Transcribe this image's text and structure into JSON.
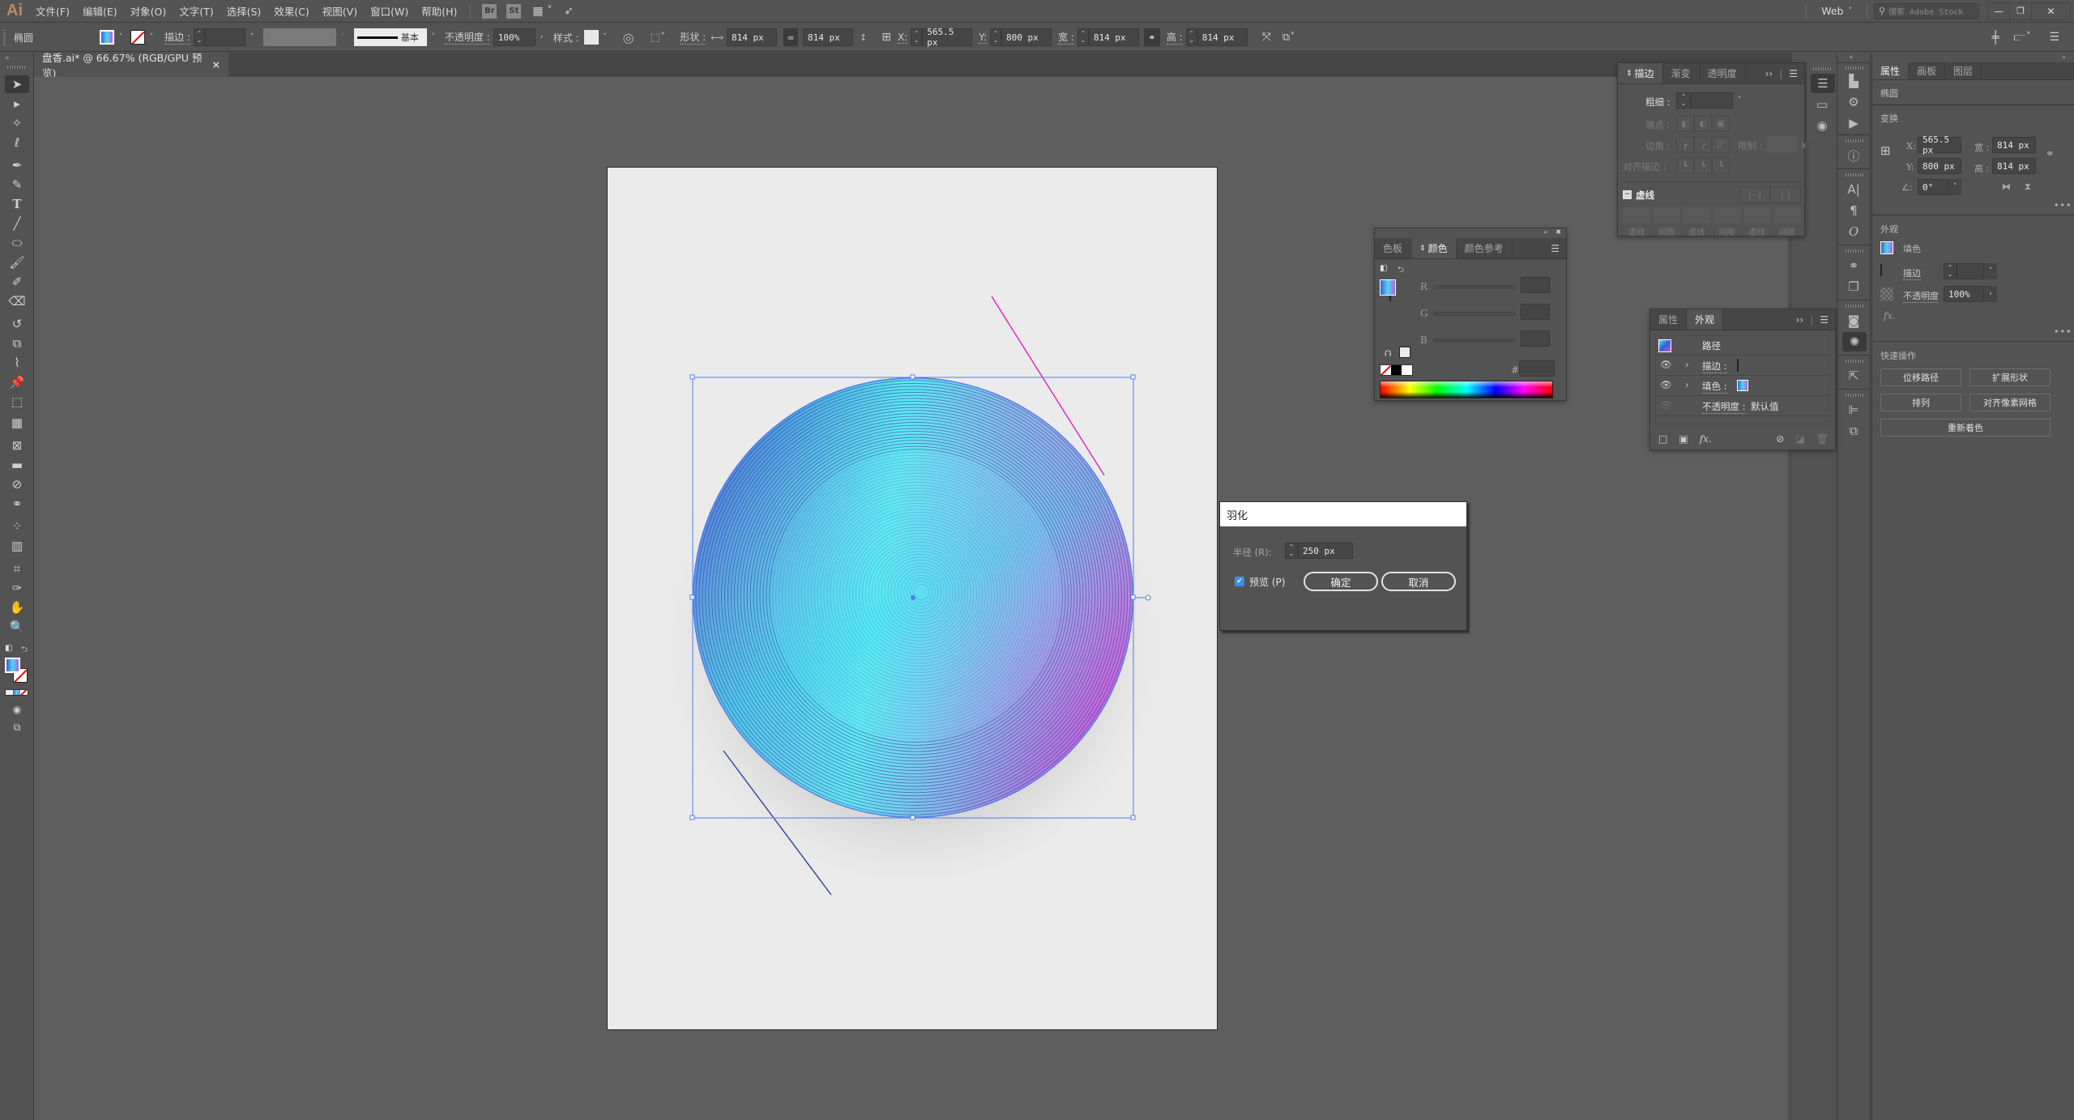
{
  "app": {
    "logo": "Ai",
    "workspace": "Web",
    "stock_search_placeholder": "搜索 Adobe Stock"
  },
  "menu": [
    "文件(F)",
    "编辑(E)",
    "对象(O)",
    "文字(T)",
    "选择(S)",
    "效果(C)",
    "视图(V)",
    "窗口(W)",
    "帮助(H)"
  ],
  "menu_icons": {
    "bridge": "Br",
    "stock": "St"
  },
  "control_bar": {
    "object_type": "椭圆",
    "stroke_label": "描边 :",
    "stroke_profile": "基本",
    "opacity_label": "不透明度 :",
    "opacity_value": "100%",
    "style_label": "样式 :",
    "shape_label": "形状 :",
    "shape_w": "814 px",
    "shape_h": "814 px",
    "x_label": "X:",
    "x_value": "565.5 px",
    "y_label": "Y:",
    "y_value": "800 px",
    "w_label": "宽 :",
    "w_value": "814 px",
    "h_label": "高 :",
    "h_value": "814 px"
  },
  "document_tab": {
    "title": "盘香.ai* @ 66.67% (RGB/GPU 预览)",
    "close": "×"
  },
  "tools": [
    "selection",
    "direct-selection",
    "magic-wand",
    "lasso",
    "pen",
    "curvature",
    "type",
    "line-segment",
    "ellipse",
    "paintbrush",
    "shaper",
    "eraser",
    "rotate",
    "scale",
    "puppet-warp",
    "pin",
    "free-transform",
    "perspective-grid",
    "mesh",
    "gradient",
    "eyedropper",
    "blend",
    "symbol-sprayer",
    "column-graph",
    "artboard",
    "slice",
    "hand",
    "zoom"
  ],
  "stroke_panel": {
    "tabs": [
      "描边",
      "渐变",
      "透明度"
    ],
    "active_tab": 0,
    "weight_label": "粗细 :",
    "cap_label": "端点 :",
    "corner_label": "边角 :",
    "limit_label": "限制 :",
    "limit_suffix": "x",
    "align_label": "对齐描边 :",
    "dashed_label": "虚线",
    "dash_fields": [
      "虚线",
      "间隙",
      "虚线",
      "间隙",
      "虚线",
      "间隙"
    ]
  },
  "color_panel": {
    "tabs": [
      "色板",
      "颜色",
      "颜色参考"
    ],
    "active_tab": 1,
    "channels": [
      "R",
      "G",
      "B"
    ],
    "hex_label": "#"
  },
  "appearance_panel": {
    "tabs": [
      "属性",
      "外观"
    ],
    "active_tab": 1,
    "object": "路径",
    "rows": [
      {
        "label": "描边 :",
        "swatch": "none",
        "visible": true
      },
      {
        "label": "填色 :",
        "swatch": "gradient",
        "visible": true
      },
      {
        "label": "不透明度 :",
        "value": "默认值",
        "visible": false
      }
    ],
    "fx": "fx."
  },
  "feather_dialog": {
    "title": "羽化",
    "radius_label": "半径 (R):",
    "radius_value": "250 px",
    "preview_label": "预览 (P)",
    "preview_checked": true,
    "ok": "确定",
    "cancel": "取消"
  },
  "properties_panel": {
    "tabs": [
      "属性",
      "画板",
      "图层"
    ],
    "active_tab": 0,
    "object_type": "椭圆",
    "transform_title": "变换",
    "x_label": "X:",
    "x_value": "565.5 px",
    "y_label": "Y:",
    "y_value": "800 px",
    "w_label": "宽 :",
    "w_value": "814 px",
    "h_label": "高 :",
    "h_value": "814 px",
    "angle_value": "0°",
    "appearance_title": "外观",
    "fill_label": "填色",
    "stroke_label": "描边",
    "opacity_label": "不透明度",
    "opacity_value": "100%",
    "fx": "fx.",
    "quick_actions_title": "快速操作",
    "quick_actions": [
      "位移路径",
      "扩展形状",
      "排列",
      "对齐像素网格",
      "重新着色"
    ]
  },
  "colors": {
    "gradient_start": "#3a5ed8",
    "gradient_mid": "#45e3ef",
    "gradient_end": "#c250d8",
    "selection": "#4f7cf0",
    "stroke_line_top": "#e020c8",
    "stroke_line_bottom": "#3040a0"
  }
}
